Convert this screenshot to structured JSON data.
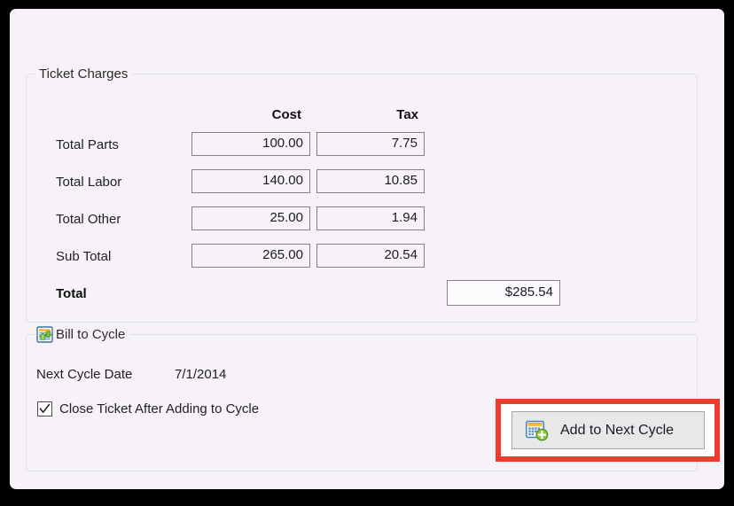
{
  "window": {
    "background_color": "#F7F2F7",
    "bezel_color": "#000000"
  },
  "ticket_charges": {
    "legend": "Ticket Charges",
    "columns": [
      "Cost",
      "Tax"
    ],
    "column_cost": "Cost",
    "column_tax": "Tax",
    "rows": [
      {
        "label": "Total Parts",
        "cost": "100.00",
        "tax": "7.75"
      },
      {
        "label": "Total Labor",
        "cost": "140.00",
        "tax": "10.85"
      },
      {
        "label": "Total Other",
        "cost": "25.00",
        "tax": "1.94"
      },
      {
        "label": "Sub Total",
        "cost": "265.00",
        "tax": "20.54"
      }
    ],
    "total": {
      "label": "Total",
      "amount": "$285.54"
    }
  },
  "bill_to_cycle": {
    "legend": "Bill to Cycle",
    "legend_icon": "recycle-list-icon",
    "next_cycle_date_label": "Next Cycle Date",
    "next_cycle_date_value": "7/1/2014",
    "close_ticket_checkbox": {
      "label": "Close Ticket After Adding to Cycle",
      "checked": true
    },
    "add_button": {
      "label": "Add to Next Cycle",
      "icon": "calendar-add-icon",
      "highlight_color": "#F03A2E"
    }
  }
}
